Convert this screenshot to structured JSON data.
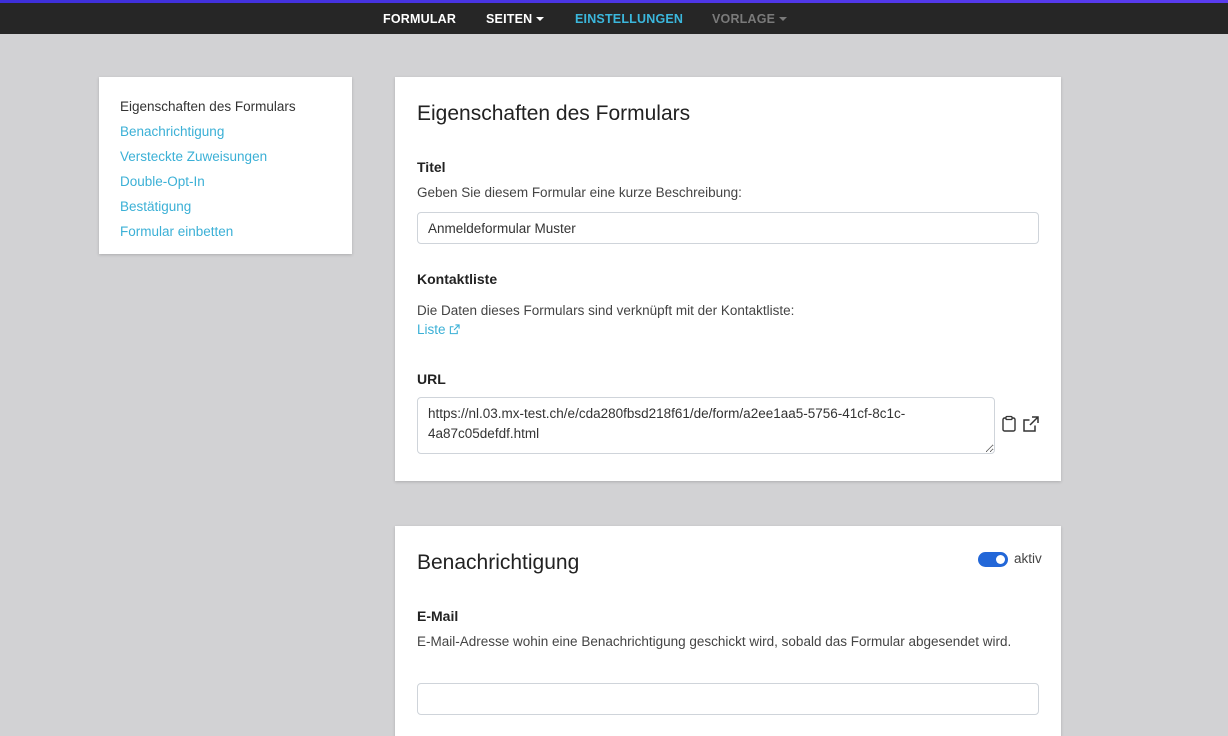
{
  "nav": {
    "items": [
      {
        "label": "FORMULAR",
        "state": "normal"
      },
      {
        "label": "SEITEN",
        "state": "dropdown"
      },
      {
        "label": "EINSTELLUNGEN",
        "state": "active"
      },
      {
        "label": "VORLAGE",
        "state": "disabled-dropdown"
      }
    ]
  },
  "sidebar": {
    "items": [
      {
        "label": "Eigenschaften des Formulars"
      },
      {
        "label": "Benachrichtigung"
      },
      {
        "label": "Versteckte Zuweisungen"
      },
      {
        "label": "Double-Opt-In"
      },
      {
        "label": "Bestätigung"
      },
      {
        "label": "Formular einbetten"
      }
    ]
  },
  "properties": {
    "heading": "Eigenschaften des Formulars",
    "title_label": "Titel",
    "title_help": "Geben Sie diesem Formular eine kurze Beschreibung:",
    "title_value": "Anmeldeformular Muster",
    "contactlist_label": "Kontaktliste",
    "contactlist_help": "Die Daten dieses Formulars sind verknüpft mit der Kontaktliste:",
    "contactlist_link": "Liste",
    "url_label": "URL",
    "url_value": "https://nl.03.mx-test.ch/e/cda280fbsd218f61/de/form/a2ee1aa5-5756-41cf-8c1c-4a87c05defdf.html"
  },
  "notification": {
    "heading": "Benachrichtigung",
    "toggle_label": "aktiv",
    "email_label": "E-Mail",
    "email_help": "E-Mail-Adresse wohin eine Benachrichtigung geschickt wird, sobald das Formular abgesendet wird.",
    "email_value": ""
  },
  "colors": {
    "accent": "#3bb7dc",
    "nav_bg": "#262626",
    "toggle_on": "#2367d8"
  }
}
